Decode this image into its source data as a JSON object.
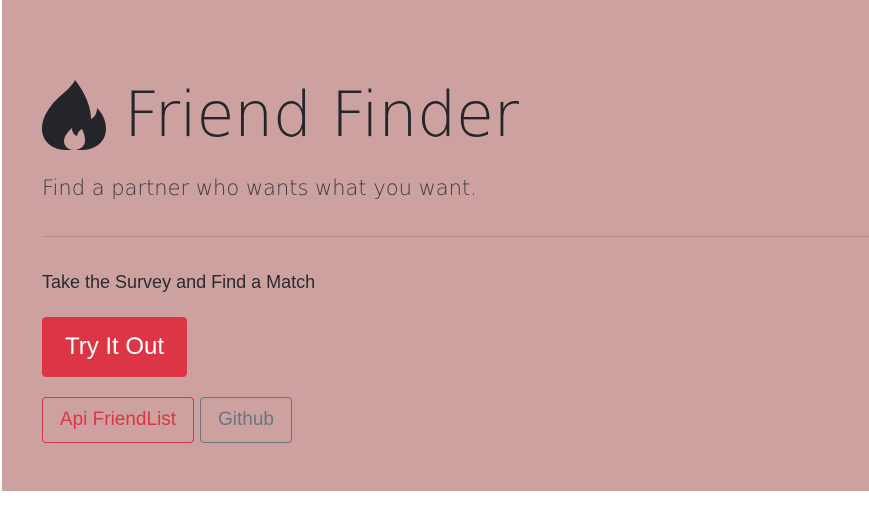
{
  "hero": {
    "title": "Friend Finder",
    "subtitle": "Find a partner who wants what you want.",
    "tagline": "Take the Survey and Find a Match",
    "icon": "fire-icon"
  },
  "actions": {
    "primary_label": "Try It Out",
    "api_label": "Api FriendList",
    "github_label": "Github"
  },
  "colors": {
    "background": "#cea1a1",
    "danger": "#dc3545",
    "secondary": "#6c757d",
    "text": "#23252b"
  }
}
